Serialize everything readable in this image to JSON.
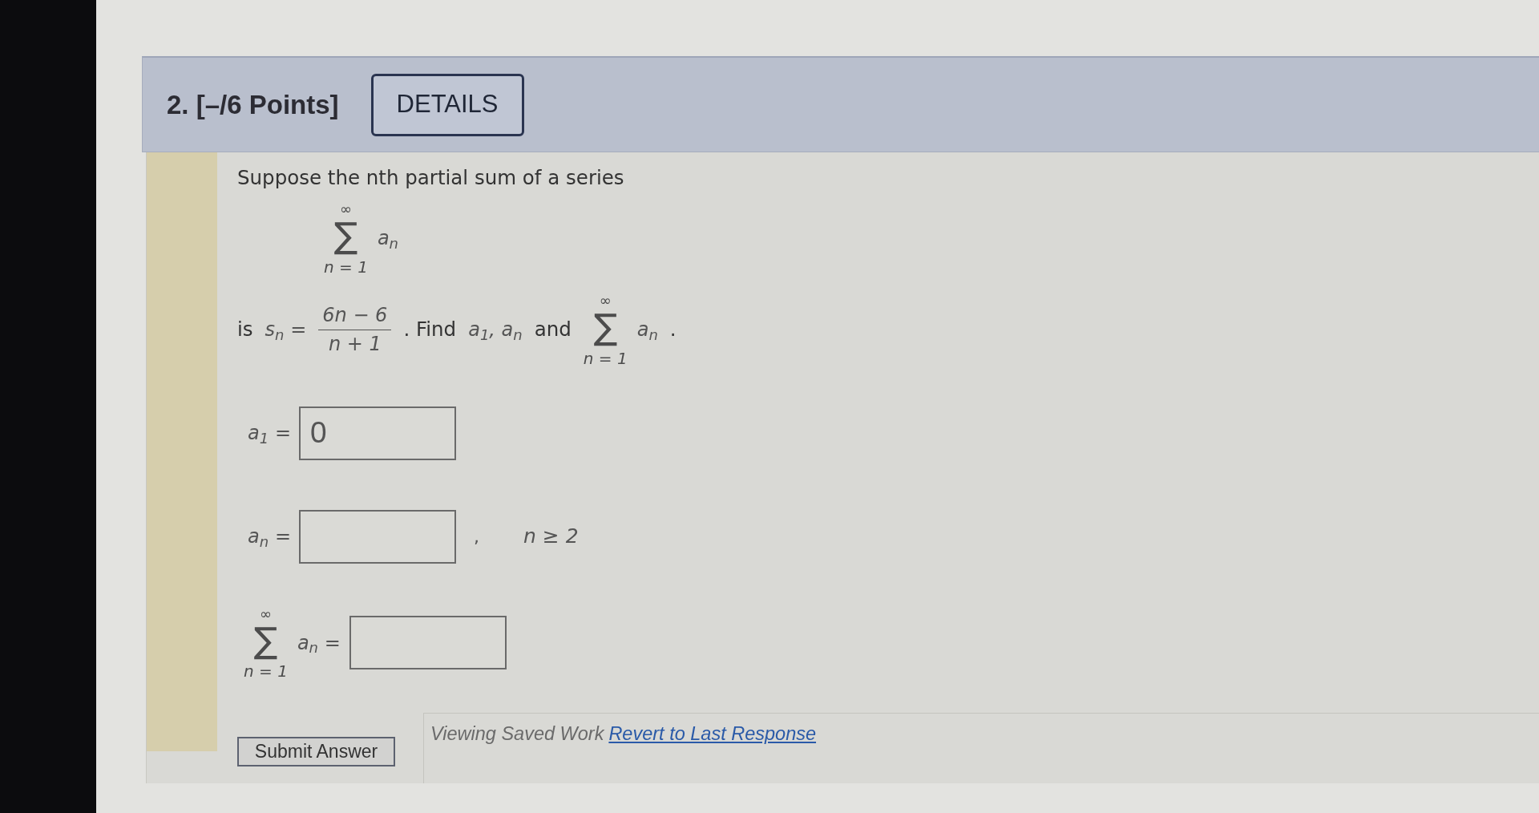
{
  "header": {
    "title": "2. [–/6 Points]",
    "details_button": "DETAILS"
  },
  "problem": {
    "intro": "Suppose the nth partial sum of a series",
    "display_sum": {
      "upper": "∞",
      "symbol": "∑",
      "lower": "n = 1",
      "term": "a$_{n}$"
    },
    "statement": [
      {
        "kind": "text",
        "text": "is"
      },
      {
        "kind": "math",
        "text": "s$_{n}$ ="
      },
      {
        "kind": "fraction",
        "numerator": "6n − 6",
        "denominator": "n + 1"
      },
      {
        "kind": "text",
        "text": ". Find"
      },
      {
        "kind": "math",
        "text": "a$_{1}$, a$_{n}$"
      },
      {
        "kind": "text",
        "text": "and"
      },
      {
        "kind": "sum",
        "upper": "∞",
        "symbol": "∑",
        "lower": "n = 1",
        "term": "a$_{n}$"
      },
      {
        "kind": "text",
        "text": "."
      }
    ]
  },
  "answers": [
    {
      "kind": "value",
      "label": "a$_{1}$ =",
      "value": "0"
    },
    {
      "kind": "value",
      "label": "a$_{n}$ =",
      "suffix": ",",
      "condition": "n ≥ 2"
    },
    {
      "kind": "sum",
      "upper": "∞",
      "symbol": "∑",
      "lower": "n = 1",
      "term": "a$_{n}$ ="
    }
  ],
  "submit_button": "Submit Answer",
  "saved_work": {
    "text": "Viewing Saved Work",
    "link": "Revert to Last Response"
  }
}
